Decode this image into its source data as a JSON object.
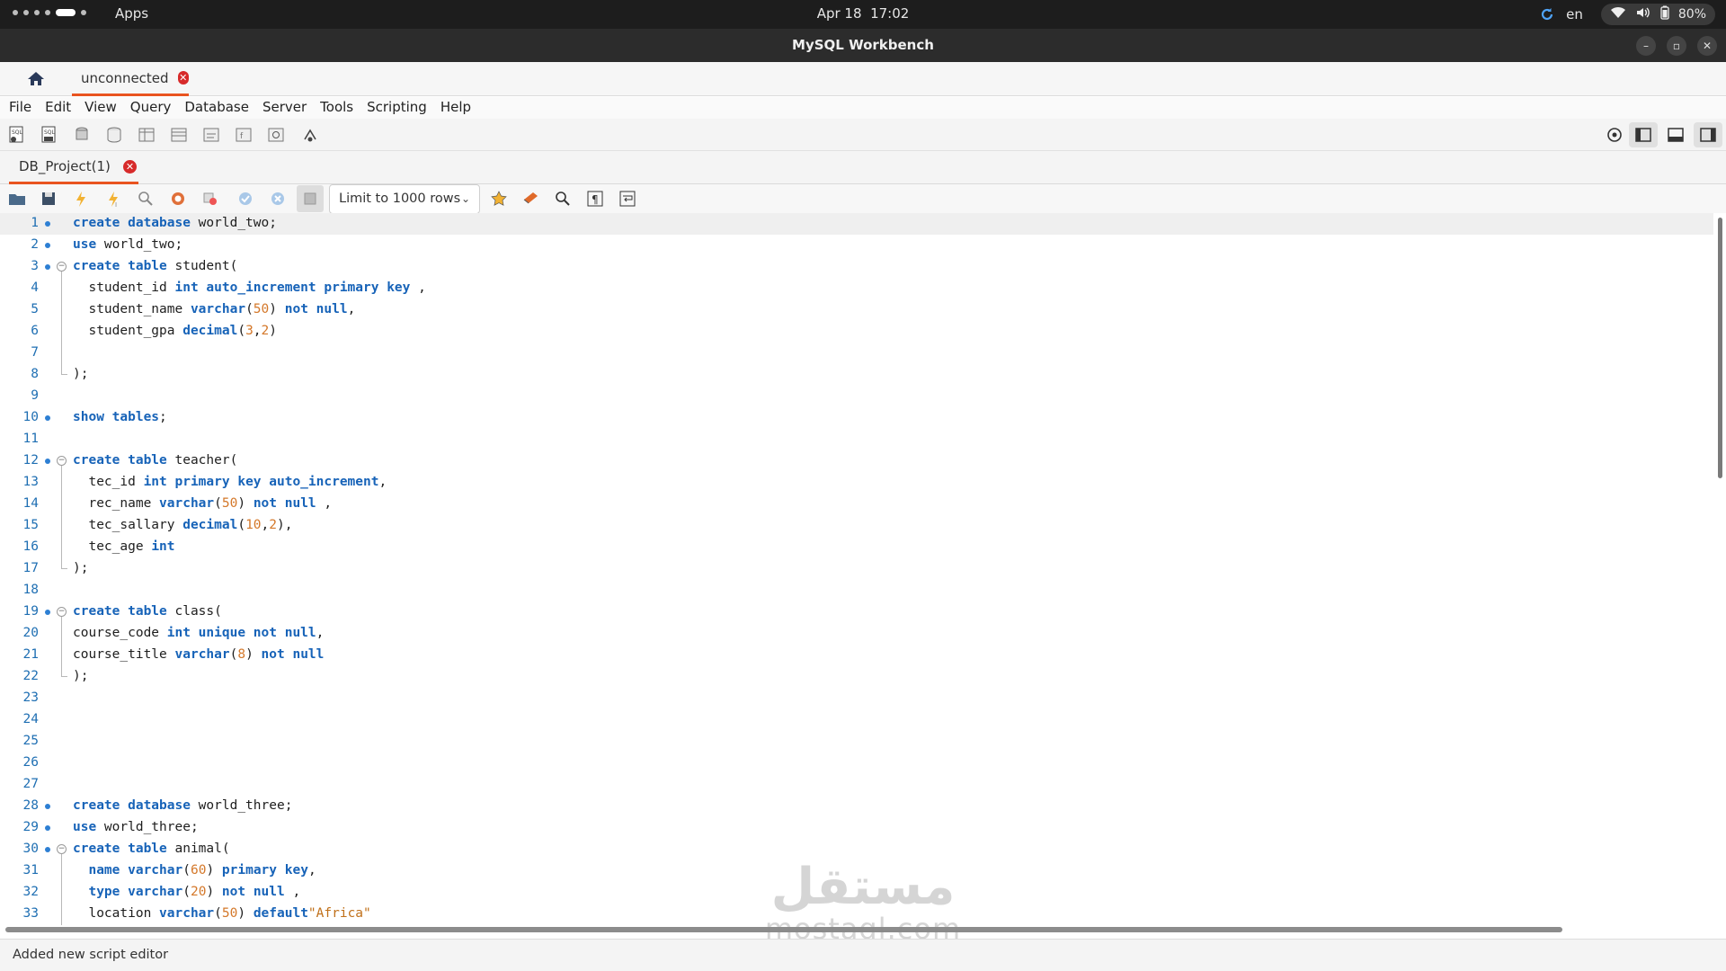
{
  "system_bar": {
    "apps_label": "Apps",
    "date": "Apr 18",
    "time": "17:02",
    "language": "en",
    "battery": "80%",
    "icons": [
      "refresh-icon",
      "wifi-icon",
      "volume-icon",
      "battery-icon"
    ]
  },
  "window": {
    "title": "MySQL Workbench",
    "controls": [
      "minimize",
      "restore",
      "close"
    ]
  },
  "connection_tabs": {
    "home_icon": "home-icon",
    "active_tab": "unconnected"
  },
  "menu": [
    "File",
    "Edit",
    "View",
    "Query",
    "Database",
    "Server",
    "Tools",
    "Scripting",
    "Help"
  ],
  "sql_tab": {
    "label": "DB_Project(1)"
  },
  "editor_toolbar": {
    "limit_select": "Limit to 1000 rows"
  },
  "editor": {
    "lines": [
      {
        "n": "1",
        "dot": true,
        "fold": "",
        "tokens": [
          [
            "kw",
            "create database"
          ],
          [
            "",
            "world_two;"
          ]
        ]
      },
      {
        "n": "2",
        "dot": true,
        "fold": "",
        "tokens": [
          [
            "kw",
            "use"
          ],
          [
            "",
            " world_two;"
          ]
        ]
      },
      {
        "n": "3",
        "dot": true,
        "fold": "start",
        "tokens": [
          [
            "kw",
            "create table"
          ],
          [
            "",
            " student("
          ]
        ]
      },
      {
        "n": "4",
        "dot": false,
        "fold": "mid",
        "tokens": [
          [
            "",
            "  student_id "
          ],
          [
            "kw",
            "int auto_increment primary key"
          ],
          [
            "",
            " ,"
          ]
        ]
      },
      {
        "n": "5",
        "dot": false,
        "fold": "mid",
        "tokens": [
          [
            "",
            "  student_name "
          ],
          [
            "kw",
            "varchar"
          ],
          [
            "",
            "("
          ],
          [
            "num",
            "50"
          ],
          [
            "",
            ") "
          ],
          [
            "kw",
            "not null"
          ],
          [
            "",
            ","
          ]
        ]
      },
      {
        "n": "6",
        "dot": false,
        "fold": "mid",
        "tokens": [
          [
            "",
            "  student_gpa "
          ],
          [
            "kw",
            "decimal"
          ],
          [
            "",
            "("
          ],
          [
            "num",
            "3"
          ],
          [
            "",
            ","
          ],
          [
            "num",
            "2"
          ],
          [
            "",
            ")"
          ]
        ]
      },
      {
        "n": "7",
        "dot": false,
        "fold": "mid",
        "tokens": []
      },
      {
        "n": "8",
        "dot": false,
        "fold": "end",
        "tokens": [
          [
            "",
            ");"
          ]
        ]
      },
      {
        "n": "9",
        "dot": false,
        "fold": "",
        "tokens": []
      },
      {
        "n": "10",
        "dot": true,
        "fold": "",
        "tokens": [
          [
            "kw",
            "show tables"
          ],
          [
            "",
            ";"
          ]
        ]
      },
      {
        "n": "11",
        "dot": false,
        "fold": "",
        "tokens": []
      },
      {
        "n": "12",
        "dot": true,
        "fold": "start",
        "tokens": [
          [
            "kw",
            "create table"
          ],
          [
            "",
            " teacher("
          ]
        ]
      },
      {
        "n": "13",
        "dot": false,
        "fold": "mid",
        "tokens": [
          [
            "",
            "  tec_id "
          ],
          [
            "kw",
            "int primary key auto_increment"
          ],
          [
            "",
            ","
          ]
        ]
      },
      {
        "n": "14",
        "dot": false,
        "fold": "mid",
        "tokens": [
          [
            "",
            "  rec_name "
          ],
          [
            "kw",
            "varchar"
          ],
          [
            "",
            "("
          ],
          [
            "num",
            "50"
          ],
          [
            "",
            ") "
          ],
          [
            "kw",
            "not null"
          ],
          [
            "",
            " ,"
          ]
        ]
      },
      {
        "n": "15",
        "dot": false,
        "fold": "mid",
        "tokens": [
          [
            "",
            "  tec_sallary "
          ],
          [
            "kw",
            "decimal"
          ],
          [
            "",
            "("
          ],
          [
            "num",
            "10"
          ],
          [
            "",
            ","
          ],
          [
            "num",
            "2"
          ],
          [
            "",
            "),"
          ]
        ]
      },
      {
        "n": "16",
        "dot": false,
        "fold": "mid",
        "tokens": [
          [
            "",
            "  tec_age "
          ],
          [
            "kw",
            "int"
          ]
        ]
      },
      {
        "n": "17",
        "dot": false,
        "fold": "end",
        "tokens": [
          [
            "",
            ");"
          ]
        ]
      },
      {
        "n": "18",
        "dot": false,
        "fold": "",
        "tokens": []
      },
      {
        "n": "19",
        "dot": true,
        "fold": "start",
        "tokens": [
          [
            "kw",
            "create table"
          ],
          [
            "",
            " class("
          ]
        ]
      },
      {
        "n": "20",
        "dot": false,
        "fold": "mid",
        "tokens": [
          [
            "",
            "course_code "
          ],
          [
            "kw",
            "int unique not null"
          ],
          [
            "",
            ","
          ]
        ]
      },
      {
        "n": "21",
        "dot": false,
        "fold": "mid",
        "tokens": [
          [
            "",
            "course_title "
          ],
          [
            "kw",
            "varchar"
          ],
          [
            "",
            "("
          ],
          [
            "num",
            "8"
          ],
          [
            "",
            ") "
          ],
          [
            "kw",
            "not null"
          ]
        ]
      },
      {
        "n": "22",
        "dot": false,
        "fold": "end",
        "tokens": [
          [
            "",
            ");"
          ]
        ]
      },
      {
        "n": "23",
        "dot": false,
        "fold": "",
        "tokens": []
      },
      {
        "n": "24",
        "dot": false,
        "fold": "",
        "tokens": []
      },
      {
        "n": "25",
        "dot": false,
        "fold": "",
        "tokens": []
      },
      {
        "n": "26",
        "dot": false,
        "fold": "",
        "tokens": []
      },
      {
        "n": "27",
        "dot": false,
        "fold": "",
        "tokens": []
      },
      {
        "n": "28",
        "dot": true,
        "fold": "",
        "tokens": [
          [
            "kw",
            "create database"
          ],
          [
            "",
            " world_three;"
          ]
        ]
      },
      {
        "n": "29",
        "dot": true,
        "fold": "",
        "tokens": [
          [
            "kw",
            "use"
          ],
          [
            "",
            " world_three;"
          ]
        ]
      },
      {
        "n": "30",
        "dot": true,
        "fold": "start",
        "tokens": [
          [
            "kw",
            "create table"
          ],
          [
            "",
            " animal("
          ]
        ]
      },
      {
        "n": "31",
        "dot": false,
        "fold": "mid",
        "tokens": [
          [
            "",
            "  "
          ],
          [
            "kw",
            "name varchar"
          ],
          [
            "",
            "("
          ],
          [
            "num",
            "60"
          ],
          [
            "",
            ") "
          ],
          [
            "kw",
            "primary key"
          ],
          [
            "",
            ","
          ]
        ]
      },
      {
        "n": "32",
        "dot": false,
        "fold": "mid",
        "tokens": [
          [
            "",
            "  "
          ],
          [
            "kw",
            "type varchar"
          ],
          [
            "",
            "("
          ],
          [
            "num",
            "20"
          ],
          [
            "",
            ") "
          ],
          [
            "kw",
            "not null"
          ],
          [
            "",
            " ,"
          ]
        ]
      },
      {
        "n": "33",
        "dot": false,
        "fold": "mid",
        "tokens": [
          [
            "",
            "  location "
          ],
          [
            "kw",
            "varchar"
          ],
          [
            "",
            "("
          ],
          [
            "num",
            "50"
          ],
          [
            "",
            ") "
          ],
          [
            "kw",
            "default"
          ],
          [
            "str",
            "\"Africa\""
          ]
        ]
      }
    ]
  },
  "watermark": {
    "top": "مستقل",
    "bottom": "mostaql.com"
  },
  "status_bar": {
    "message": "Added new script editor"
  },
  "colors": {
    "accent": "#e95420",
    "keyword": "#1763b8",
    "number": "#d4782a",
    "line_number": "#1f6fb3"
  }
}
